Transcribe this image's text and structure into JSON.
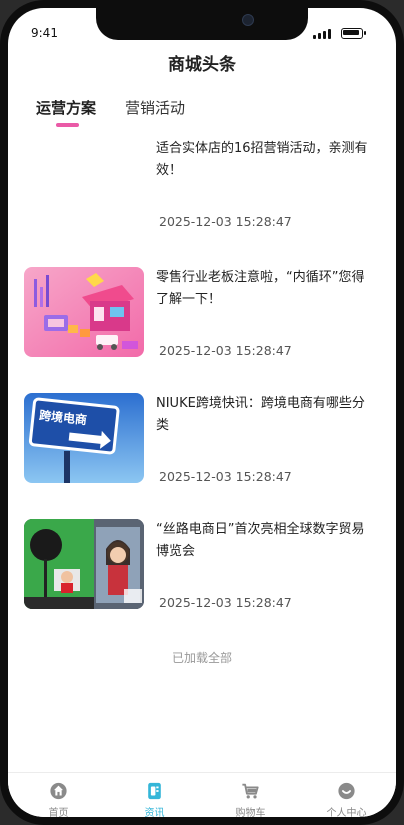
{
  "status_bar": {
    "time": "9:41"
  },
  "header": {
    "title": "商城头条"
  },
  "tabs": [
    {
      "label": "运营方案",
      "active": true
    },
    {
      "label": "营销活动",
      "active": false
    }
  ],
  "accent_color": "#ea5aa7",
  "articles": [
    {
      "title": "适合实体店的16招营销活动，亲测有效！",
      "date": "2025-12-03 15:28:47",
      "image": "none"
    },
    {
      "title": "零售行业老板注意啦，“内循环”您得了解一下！",
      "date": "2025-12-03 15:28:47",
      "image": "retail-shop-illustration"
    },
    {
      "title": "NIUKE跨境快讯：跨境电商有哪些分类",
      "date": "2025-12-03 15:28:47",
      "image": "road-sign-photo",
      "image_text": "跨境电商"
    },
    {
      "title": "“丝路电商日”首次亮相全球数字贸易博览会",
      "date": "2025-12-03 15:28:47",
      "image": "livestream-studio-photo"
    }
  ],
  "list_end_text": "已加载全部",
  "bottom_nav": [
    {
      "label": "首页",
      "icon": "home-icon",
      "active": false
    },
    {
      "label": "资讯",
      "icon": "news-icon",
      "active": true
    },
    {
      "label": "购物车",
      "icon": "cart-icon",
      "active": false
    },
    {
      "label": "个人中心",
      "icon": "profile-icon",
      "active": false
    }
  ],
  "nav_active_color": "#34b6d8",
  "nav_inactive_color": "#8a8a8a"
}
